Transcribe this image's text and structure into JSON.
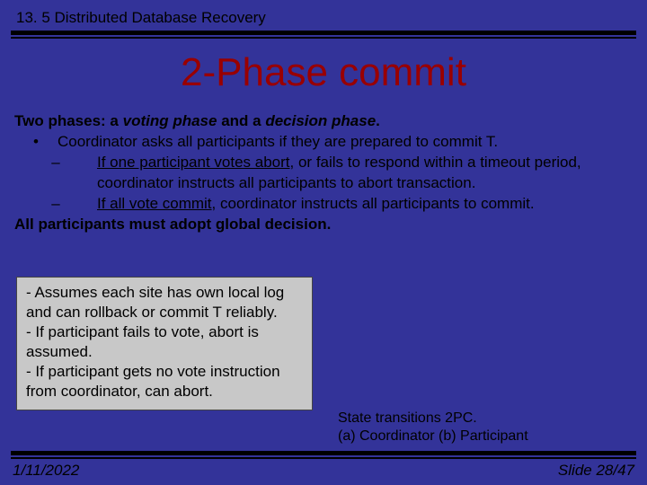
{
  "header": {
    "section": "13. 5 Distributed Database Recovery"
  },
  "title": "2-Phase commit",
  "body": {
    "lead_pre": "Two phases: a ",
    "lead_em1": "voting phase",
    "lead_mid": " and a ",
    "lead_em2": "decision phase",
    "lead_post": ".",
    "bullet_mark": "•",
    "bullet_text": "Coordinator asks all participants if they are prepared to commit T.",
    "dash_mark": "–",
    "sub1_u": "If one participant votes abort",
    "sub1_rest": ", or fails to respond within a timeout period, coordinator instructs all participants to abort transaction.",
    "sub2_u": "If all vote commit",
    "sub2_rest": ", coordinator instructs all participants to commit.",
    "closing": "All participants must adopt global decision."
  },
  "box": {
    "l1": "- Assumes each site has own local log and can rollback or commit T reliably.",
    "l2": "- If participant fails to vote, abort is assumed.",
    "l3": "- If participant gets no vote instruction from coordinator, can abort."
  },
  "caption": {
    "l1": "State transitions 2PC.",
    "l2": "(a) Coordinator (b) Participant"
  },
  "footer": {
    "date": "1/11/2022",
    "slide": "Slide 28/47"
  }
}
